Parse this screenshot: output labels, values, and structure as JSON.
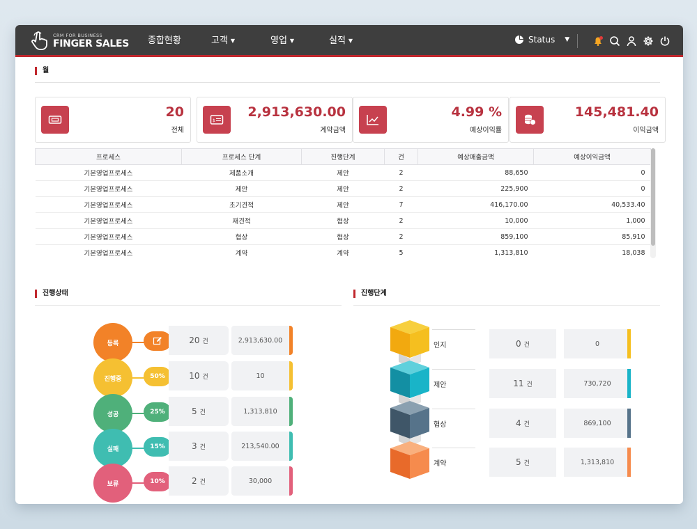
{
  "brand": {
    "small": "CRM FOR BUSINESS",
    "big": "FINGER SALES"
  },
  "nav": [
    {
      "label": "종합현황",
      "has_caret": false
    },
    {
      "label": "고객",
      "has_caret": true
    },
    {
      "label": "영업",
      "has_caret": true
    },
    {
      "label": "실적",
      "has_caret": true
    }
  ],
  "status_menu": {
    "label": "Status"
  },
  "header_icons": [
    "bell-icon",
    "search-icon",
    "user-icon",
    "gear-icon",
    "power-icon"
  ],
  "sections": {
    "monthly": "월",
    "progress_status": "진행상태",
    "progress_stage": "진행단계"
  },
  "stats": [
    {
      "value": "20",
      "label": "전체",
      "icon": "ticket-icon"
    },
    {
      "value": "2,913,630.00",
      "label": "계약금액",
      "icon": "card-icon"
    },
    {
      "value": "4.99 %",
      "label": "예상이익률",
      "icon": "chart-icon"
    },
    {
      "value": "145,481.40",
      "label": "이익금액",
      "icon": "coins-icon"
    }
  ],
  "table": {
    "headers": [
      "프로세스",
      "프로세스 단계",
      "진행단계",
      "건",
      "예상매출금액",
      "예상이익금액"
    ],
    "rows": [
      [
        "기본영업프로세스",
        "제품소개",
        "제안",
        "2",
        "88,650",
        "0"
      ],
      [
        "기본영업프로세스",
        "제안",
        "제안",
        "2",
        "225,900",
        "0"
      ],
      [
        "기본영업프로세스",
        "초기견적",
        "제안",
        "7",
        "416,170.00",
        "40,533.40"
      ],
      [
        "기본영업프로세스",
        "재견적",
        "협상",
        "2",
        "10,000",
        "1,000"
      ],
      [
        "기본영업프로세스",
        "협상",
        "협상",
        "2",
        "859,100",
        "85,910"
      ],
      [
        "기본영업프로세스",
        "계약",
        "계약",
        "5",
        "1,313,810",
        "18,038"
      ]
    ]
  },
  "progress_status": [
    {
      "name": "등록",
      "badge": "",
      "count": "20",
      "unit": "건",
      "amount": "2,913,630.00",
      "color": "#f28228"
    },
    {
      "name": "진행중",
      "badge": "50%",
      "count": "10",
      "unit": "건",
      "amount": "10",
      "color": "#f5c032"
    },
    {
      "name": "성공",
      "badge": "25%",
      "count": "5",
      "unit": "건",
      "amount": "1,313,810",
      "color": "#4fb07a"
    },
    {
      "name": "실패",
      "badge": "15%",
      "count": "3",
      "unit": "건",
      "amount": "213,540.00",
      "color": "#3fbdb1"
    },
    {
      "name": "보류",
      "badge": "10%",
      "count": "2",
      "unit": "건",
      "amount": "30,000",
      "color": "#e2607b"
    }
  ],
  "progress_stage": [
    {
      "name": "인지",
      "count": "0",
      "unit": "건",
      "amount": "0",
      "color": "#f5bf1f"
    },
    {
      "name": "제안",
      "count": "11",
      "unit": "건",
      "amount": "730,720",
      "color": "#19b4c8"
    },
    {
      "name": "협상",
      "count": "4",
      "unit": "건",
      "amount": "869,100",
      "color": "#56738a"
    },
    {
      "name": "계약",
      "count": "5",
      "unit": "건",
      "amount": "1,313,810",
      "color": "#f68b4d"
    }
  ]
}
